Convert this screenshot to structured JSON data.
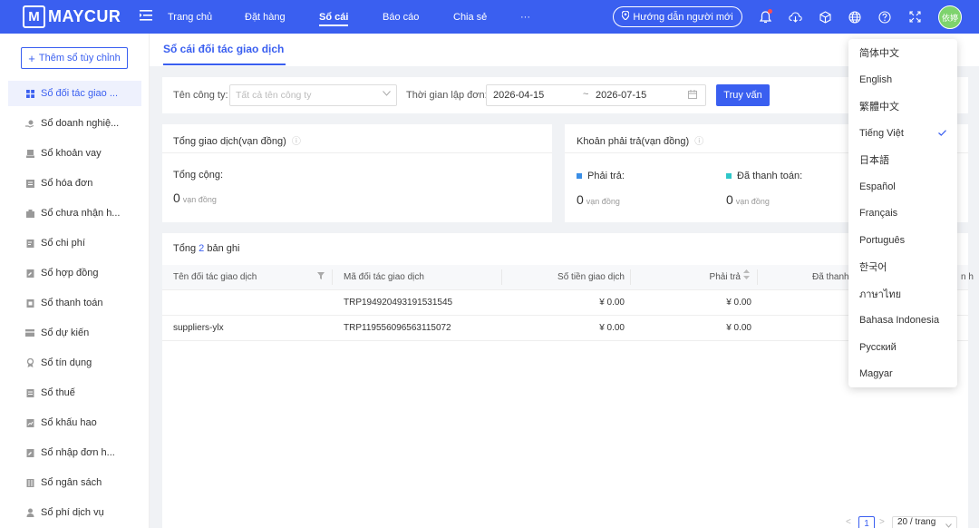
{
  "app": {
    "brand": "MAYCUR",
    "brand_mark": "M",
    "avatar_text": "依婷"
  },
  "nav": {
    "items": [
      "Trang chủ",
      "Đặt hàng",
      "Sổ cái",
      "Báo cáo",
      "Chia sẻ",
      "···"
    ],
    "active": "Sổ cái",
    "guide_label": "Hướng dẫn người mới"
  },
  "sidebar": {
    "add_label": "Thêm sổ tùy chỉnh",
    "items": [
      {
        "label": "Sổ đối tác giao ...",
        "icon": "grid-icon",
        "active": true
      },
      {
        "label": "Sổ doanh nghiệ...",
        "icon": "coin-hand-icon"
      },
      {
        "label": "Sổ khoản vay",
        "icon": "loan-icon"
      },
      {
        "label": "Sổ hóa đơn",
        "icon": "invoice-icon"
      },
      {
        "label": "Sổ chưa nhận h...",
        "icon": "package-icon"
      },
      {
        "label": "Sổ chi phí",
        "icon": "expense-icon"
      },
      {
        "label": "Sổ hợp đồng",
        "icon": "contract-icon"
      },
      {
        "label": "Sổ thanh toán",
        "icon": "payment-icon"
      },
      {
        "label": "Sổ dự kiến",
        "icon": "forecast-icon"
      },
      {
        "label": "Sổ tín dụng",
        "icon": "credit-icon"
      },
      {
        "label": "Sổ thuế",
        "icon": "tax-icon"
      },
      {
        "label": "Sổ khấu hao",
        "icon": "depreciation-icon"
      },
      {
        "label": "Sổ nhập đơn h...",
        "icon": "import-icon"
      },
      {
        "label": "Sổ ngân sách",
        "icon": "budget-icon"
      },
      {
        "label": "Sổ phí dịch vụ",
        "icon": "service-fee-icon"
      }
    ]
  },
  "page": {
    "tab_title": "Sổ cái đối tác giao dịch"
  },
  "filters": {
    "company_label": "Tên công ty:",
    "company_placeholder": "Tất cả tên công ty",
    "date_label": "Thời gian lập đơn:",
    "date_from": "2026-04-15",
    "date_sep": "~",
    "date_to": "2026-07-15",
    "query_label": "Truy vấn"
  },
  "summary": {
    "left": {
      "title": "Tổng giao dịch(vạn đồng)",
      "total_label": "Tổng cộng:",
      "total_value": "0",
      "unit": "vạn đồng"
    },
    "right": {
      "title": "Khoản phải trả(vạn đồng)",
      "payable_label": "Phải trả:",
      "payable_value": "0",
      "paid_label": "Đã thanh toán:",
      "paid_value": "0",
      "unit": "vạn đồng",
      "payable_color": "#3a8ee6",
      "paid_color": "#2ec7c9"
    }
  },
  "table": {
    "total_prefix": "Tổng",
    "total_count": "2",
    "total_suffix": "bản ghi",
    "columns": [
      "Tên đối tác giao dịch",
      "Mã đối tác giao dịch",
      "Số tiền giao dịch",
      "Phải trả",
      "Đã thanh",
      "n h"
    ],
    "rows": [
      {
        "name": "",
        "code": "TRP194920493191531545",
        "amount": "¥ 0.00",
        "payable": "¥ 0.00"
      },
      {
        "name": "suppliers-ylx",
        "code": "TRP119556096563115072",
        "amount": "¥ 0.00",
        "payable": "¥ 0.00"
      }
    ]
  },
  "pagination": {
    "prev": "<",
    "current": "1",
    "next": ">",
    "page_size": "20 / trang"
  },
  "language_menu": {
    "items": [
      "简体中文",
      "English",
      "繁體中文",
      "Tiếng Việt",
      "日本語",
      "Español",
      "Français",
      "Português",
      "한국어",
      "ภาษาไทย",
      "Bahasa Indonesia",
      "Русский",
      "Magyar"
    ],
    "selected": "Tiếng Việt"
  },
  "colors": {
    "primary": "#3a5ff0",
    "avatar": "#7ed36d",
    "notification": "#ff4d4f"
  }
}
